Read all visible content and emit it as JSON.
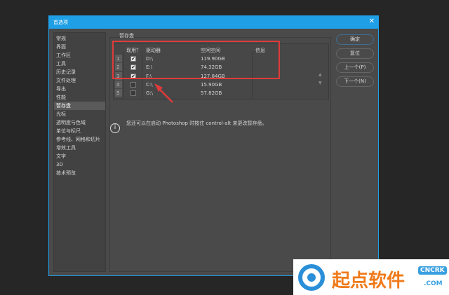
{
  "dialog": {
    "title": "首选项",
    "close": "✕"
  },
  "sidebar": {
    "items": [
      "常规",
      "界面",
      "工作区",
      "工具",
      "历史记录",
      "文件处理",
      "导出",
      "性能",
      "暂存盘",
      "光标",
      "透明度与色域",
      "单位与标尺",
      "参考线、网格和切片",
      "增效工具",
      "文字",
      "3D",
      "技术预览"
    ],
    "selected": "暂存盘"
  },
  "section": {
    "title": "暂存盘"
  },
  "table": {
    "headers": [
      "现用？",
      "驱动器",
      "空闲空间",
      "信息"
    ],
    "rows": [
      {
        "index": "1",
        "active": true,
        "drive": "D:\\",
        "free": "119.90GB",
        "info": ""
      },
      {
        "index": "2",
        "active": true,
        "drive": "E:\\",
        "free": "74.32GB",
        "info": ""
      },
      {
        "index": "3",
        "active": true,
        "drive": "F:\\",
        "free": "127.84GB",
        "info": ""
      },
      {
        "index": "4",
        "active": false,
        "drive": "C:\\",
        "free": "15.90GB",
        "info": ""
      },
      {
        "index": "5",
        "active": false,
        "drive": "G:\\",
        "free": "57.82GB",
        "info": ""
      }
    ]
  },
  "info_text": "您还可以在启动 Photoshop 时按住 control-alt 来更改暂存盘。",
  "buttons": {
    "ok": "确定",
    "reset": "复位",
    "prev": "上一个(P)",
    "next": "下一个(N)"
  },
  "watermark": {
    "text": "起点软件",
    "site": "CNCRK",
    ".com": ".COM"
  },
  "colors": {
    "accent": "#1e9fe6",
    "annotation": "#e03a3a"
  }
}
